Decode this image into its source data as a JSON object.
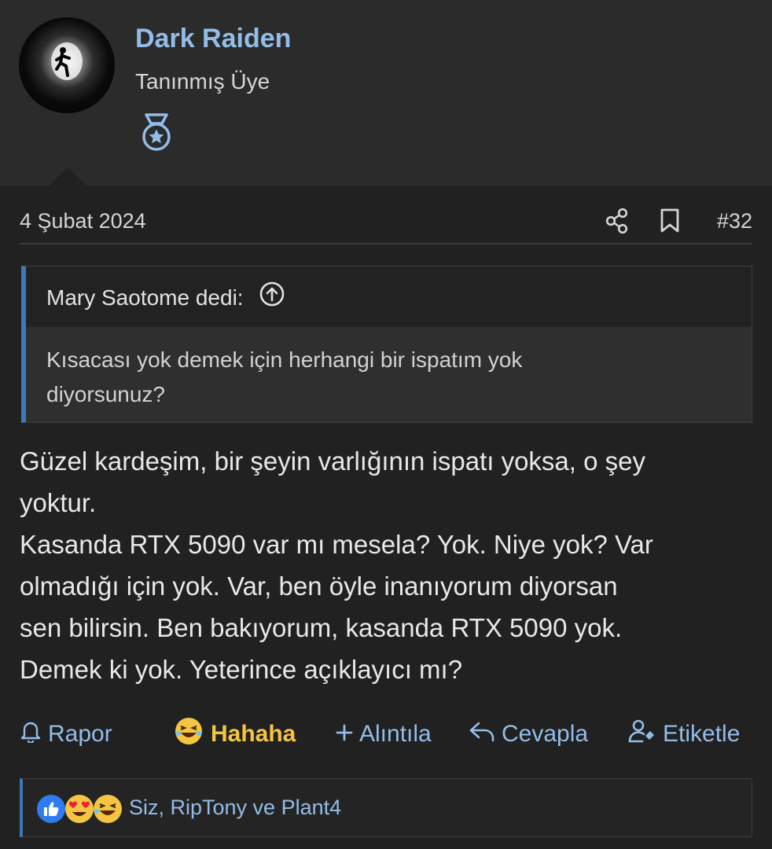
{
  "user": {
    "name": "Dark Raiden",
    "title": "Tanınmış Üye"
  },
  "post": {
    "date": "4 Şubat 2024",
    "number": "#32",
    "quote": {
      "author": "Mary Saotome dedi:",
      "text_line1": "Kısacası yok demek için herhangi bir ispatım yok",
      "text_line2": "diyorsunuz?"
    },
    "body": [
      "Güzel kardeşim, bir şeyin varlığının ispatı yoksa, o şey",
      "yoktur.",
      "Kasanda RTX 5090 var mı mesela? Yok. Niye yok? Var",
      "olmadığı için yok. Var, ben öyle inanıyorum diyorsan",
      "sen bilirsin. Ben bakıyorum, kasanda RTX 5090 yok.",
      "Demek ki yok. Yeterince açıklayıcı mı?"
    ]
  },
  "actions": {
    "report": "Rapor",
    "haha": "Hahaha",
    "quote": "Alıntıla",
    "reply": "Cevapla",
    "tag": "Etiketle"
  },
  "reactions": {
    "icons": [
      "like-icon",
      "heart-eyes-icon",
      "laughing-icon"
    ],
    "text": "Siz, RipTony ve Plant4"
  },
  "colors": {
    "accent": "#93bde8",
    "quote_border": "#3f78b8",
    "haha": "#f4c542",
    "background": "#212121"
  }
}
